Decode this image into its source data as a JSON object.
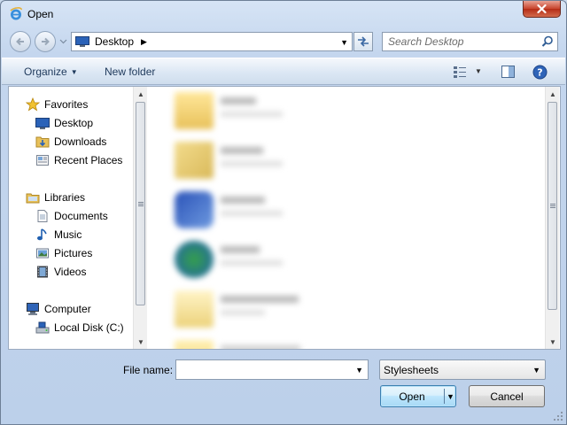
{
  "window": {
    "title": "Open"
  },
  "address": {
    "location": "Desktop"
  },
  "search": {
    "placeholder": "Search Desktop"
  },
  "toolbar": {
    "organize_label": "Organize",
    "new_folder_label": "New folder"
  },
  "nav": {
    "favorites": {
      "label": "Favorites",
      "items": [
        {
          "label": "Desktop",
          "icon": "desktop-icon"
        },
        {
          "label": "Downloads",
          "icon": "downloads-folder-icon"
        },
        {
          "label": "Recent Places",
          "icon": "recent-places-icon"
        }
      ]
    },
    "libraries": {
      "label": "Libraries",
      "items": [
        {
          "label": "Documents",
          "icon": "documents-icon"
        },
        {
          "label": "Music",
          "icon": "music-icon"
        },
        {
          "label": "Pictures",
          "icon": "pictures-icon"
        },
        {
          "label": "Videos",
          "icon": "videos-icon"
        }
      ]
    },
    "computer": {
      "label": "Computer",
      "items": [
        {
          "label": "Local Disk (C:)",
          "icon": "local-disk-icon"
        }
      ]
    }
  },
  "bottom": {
    "file_name_label": "File name:",
    "file_name_value": "",
    "file_type": "Stylesheets",
    "open_label": "Open",
    "cancel_label": "Cancel"
  },
  "colors": {
    "accent": "#3c7fb1",
    "title_bg": "#c4d6ee",
    "close": "#c7432b"
  }
}
